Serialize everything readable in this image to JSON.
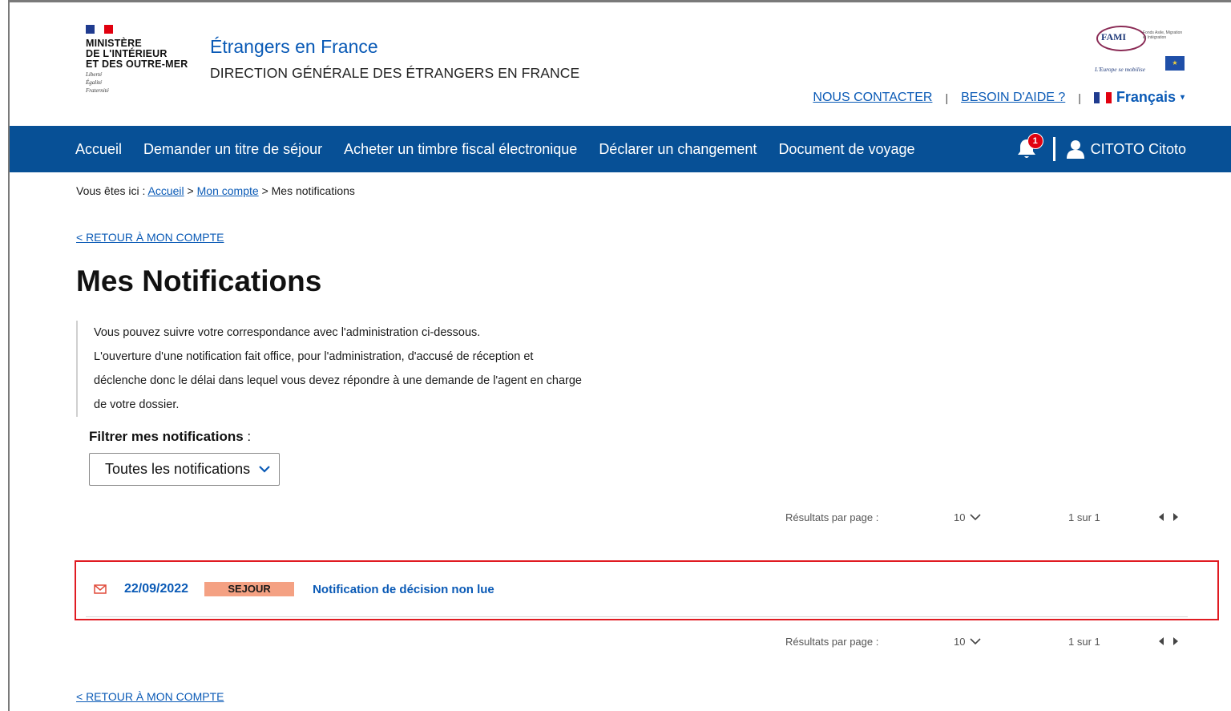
{
  "header": {
    "ministry_lines": [
      "MINISTÈRE",
      "DE L'INTÉRIEUR",
      "ET DES OUTRE-MER"
    ],
    "ministry_motto": [
      "Liberté",
      "Égalité",
      "Fraternité"
    ],
    "site_title": "Étrangers en France",
    "site_subtitle": "DIRECTION GÉNÉRALE DES ÉTRANGERS EN FRANCE",
    "fami_logo": {
      "name": "FAMI",
      "subtitle": "Fonds Asile, Migration et Intégration",
      "inner": "Union européenne",
      "tagline": "L'Europe se mobilise"
    },
    "links": {
      "contact": "NOUS CONTACTER",
      "help": "BESOIN D'AIDE ?",
      "separator": "|",
      "language": "Français"
    }
  },
  "navbar": {
    "items": [
      "Accueil",
      "Demander un titre de séjour",
      "Acheter un timbre fiscal électronique",
      "Déclarer un changement",
      "Document de voyage"
    ],
    "notification_count": "1",
    "user_name": "CITOTO Citoto"
  },
  "breadcrumb": {
    "prefix": "Vous êtes ici :",
    "home": "Accueil",
    "account": "Mon compte",
    "separator": ">",
    "current": "Mes notifications"
  },
  "back_link": "< RETOUR À MON COMPTE",
  "page_title": "Mes Notifications",
  "intro": {
    "line1": "Vous pouvez suivre votre correspondance avec l'administration ci-dessous.",
    "line2": "L'ouverture d'une notification fait office, pour l'administration, d'accusé de réception et",
    "line3": "déclenche donc le délai dans lequel vous devez répondre à une demande de l'agent en charge",
    "line4": "de votre dossier."
  },
  "filter": {
    "label": "Filtrer mes notifications",
    "colon": " :",
    "selected": "Toutes les notifications"
  },
  "pager": {
    "label": "Résultats par page :",
    "per_page": "10",
    "page_info": "1 sur 1"
  },
  "notifications": [
    {
      "date": "22/09/2022",
      "tag": "SEJOUR",
      "title": "Notification de décision non lue",
      "icon": "envelope-icon"
    }
  ],
  "colors": {
    "primary_blue": "#0a5ab6",
    "nav_blue": "#075096",
    "tag_salmon": "#f4a183",
    "highlight_red": "#e01b22",
    "badge_red": "#e1000f"
  }
}
